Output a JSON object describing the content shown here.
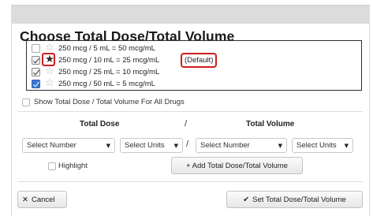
{
  "dialog": {
    "title": "Choose Total Dose/Total Volume"
  },
  "options": [
    {
      "label": "250 mcg / 5 mL = 50 mcg/mL",
      "checked": false,
      "star": "outline"
    },
    {
      "label": "250 mcg / 10 mL = 25 mcg/mL",
      "checked": true,
      "star": "filled",
      "tag": "(Default)"
    },
    {
      "label": "250 mcg / 25 mL = 10 mcg/mL",
      "checked": true,
      "star": "outline"
    },
    {
      "label": "250 mcg / 50 mL = 5 mcg/mL",
      "checked": true,
      "star": "outline"
    }
  ],
  "show_all": {
    "label": "Show Total Dose / Total Volume For All Drugs",
    "checked": false
  },
  "headers": {
    "total_dose": "Total Dose",
    "divider": "/",
    "total_volume": "Total Volume"
  },
  "selects": {
    "dose_number": "Select Number",
    "dose_units": "Select Units",
    "volume_number": "Select Number",
    "volume_units": "Select Units",
    "divider": "/"
  },
  "highlight": {
    "label": "Highlight",
    "checked": false
  },
  "buttons": {
    "add": "+ Add Total Dose/Total Volume",
    "cancel": "Cancel",
    "set": "Set Total Dose/Total Volume"
  },
  "icons": {
    "cancel": "close-icon",
    "set": "checkmark-icon",
    "star_filled": "star-filled-icon",
    "star_outline": "star-outline-icon"
  },
  "colors": {
    "highlight_red": "#d11e1e",
    "checkbox_blue": "#3a77d0"
  }
}
